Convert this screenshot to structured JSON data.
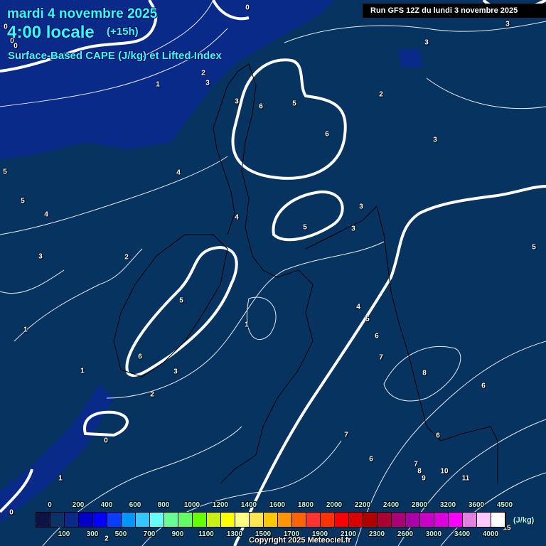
{
  "header": {
    "date": "mardi 4 novembre 2025",
    "time": "4:00 locale",
    "lead": "(+15h)",
    "subtitle": "Surface-Based CAPE (J/kg) et Lifted Index",
    "run": "Run GFS 12Z du lundi 3 novembre 2025"
  },
  "contour_labels": [
    "0",
    "0",
    "0",
    "0",
    "2",
    "3",
    "1",
    "3",
    "6",
    "5",
    "6",
    "2",
    "3",
    "3",
    "3",
    "4",
    "5",
    "5",
    "4",
    "4",
    "3",
    "3",
    "5",
    "5",
    "3",
    "2",
    "5",
    "1",
    "4",
    "5",
    "6",
    "7",
    "1",
    "6",
    "3",
    "1",
    "8",
    "2",
    "6",
    "0",
    "7",
    "6",
    "6",
    "7",
    "8",
    "9",
    "10",
    "11",
    "1",
    "0",
    "2",
    "15"
  ],
  "legend": {
    "unit": "(J/kg)",
    "top_labels": [
      "0",
      "200",
      "400",
      "600",
      "800",
      "1000",
      "1200",
      "1400",
      "1600",
      "1800",
      "2000",
      "2200",
      "2400",
      "2800",
      "3200",
      "3600",
      "4500"
    ],
    "bottom_labels": [
      "100",
      "300",
      "500",
      "700",
      "900",
      "1100",
      "1300",
      "1500",
      "1700",
      "1900",
      "2100",
      "2300",
      "2600",
      "3000",
      "3400",
      "4000"
    ],
    "colors": [
      "#0c1445",
      "#0a3366",
      "#0a2a8a",
      "#0000c8",
      "#0000ff",
      "#0a3cff",
      "#0096ff",
      "#32c8ff",
      "#64ffff",
      "#64ff96",
      "#64ff64",
      "#64ff00",
      "#c8f014",
      "#ffff00",
      "#ffff82",
      "#ffe650",
      "#ffc800",
      "#ff9600",
      "#ff6400",
      "#ff3232",
      "#ff3200",
      "#ff0000",
      "#dc0000",
      "#b40000",
      "#aa0032",
      "#aa0078",
      "#aa00aa",
      "#c800c8",
      "#dc00dc",
      "#ff00ff",
      "#e182e1",
      "#ffc8ff",
      "#ffffff"
    ]
  },
  "copyright": "Copyright 2025 Meteociel.fr",
  "colors": {
    "background": "#06335f",
    "low_cape": "#0a2a8a",
    "title": "#33ffff"
  }
}
